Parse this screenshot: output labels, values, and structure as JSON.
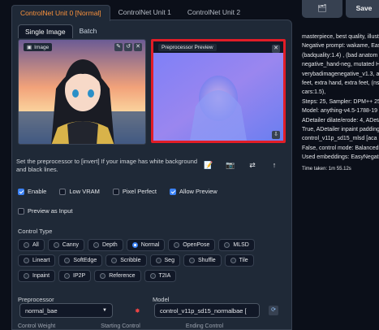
{
  "unit_tabs": [
    "ControlNet Unit 0 [Normal]",
    "ControlNet Unit 1",
    "ControlNet Unit 2"
  ],
  "mode_tabs": [
    "Single Image",
    "Batch"
  ],
  "image_label": "Image",
  "preview_label": "Preprocessor Preview",
  "hint": "Set the preprocessor to [invert] If your image has white background and black lines.",
  "tools": [
    "📝",
    "📷",
    "⇄",
    "↑"
  ],
  "checkboxes": {
    "enable": "Enable",
    "low_vram": "Low VRAM",
    "pixel_perfect": "Pixel Perfect",
    "allow_preview": "Allow Preview",
    "preview_input": "Preview as Input"
  },
  "control_type_label": "Control Type",
  "control_types_row1": [
    "All",
    "Canny",
    "Depth",
    "Normal",
    "OpenPose",
    "MLSD"
  ],
  "control_types_row2": [
    "Lineart",
    "SoftEdge",
    "Scribble",
    "Seg",
    "Shuffle",
    "Tile"
  ],
  "control_types_row3": [
    "Inpaint",
    "IP2P",
    "Reference",
    "T2IA"
  ],
  "selected_control_type": "Normal",
  "preprocessor_label": "Preprocessor",
  "preprocessor_value": "normal_bae",
  "model_label": "Model",
  "model_value": "control_v11p_sd15_normalbae [",
  "bottom_labels": [
    "Control Weight",
    "Starting Control",
    "Ending Control"
  ],
  "right_buttons": [
    "🗂",
    "Save"
  ],
  "right_text": [
    "masterpiece, best quality, illust",
    "Negative prompt: wakame, Eas",
    "(badquality:1.4) , (bad anatom",
    "negative_hand-neg, mutated H",
    "verybadimagenegative_v1.3, a",
    "feet, extra hand, extra feet, (ns",
    "feet, extra hand, extra feet, (nsf",
    "cars:1.5),",
    "Steps: 25, Sampler: DPM++ 25",
    "Model: anything-v4.5-1788-19",
    "ADetailer dilate/erode: 4, ADeta",
    "True, ADetailer inpaint padding",
    "control_v11p_sd15_mlsd [aca",
    "False, control mode: Balanced,",
    "Used embeddings: EasyNegati"
  ],
  "time_taken": "Time taken: 1m 55.12s"
}
